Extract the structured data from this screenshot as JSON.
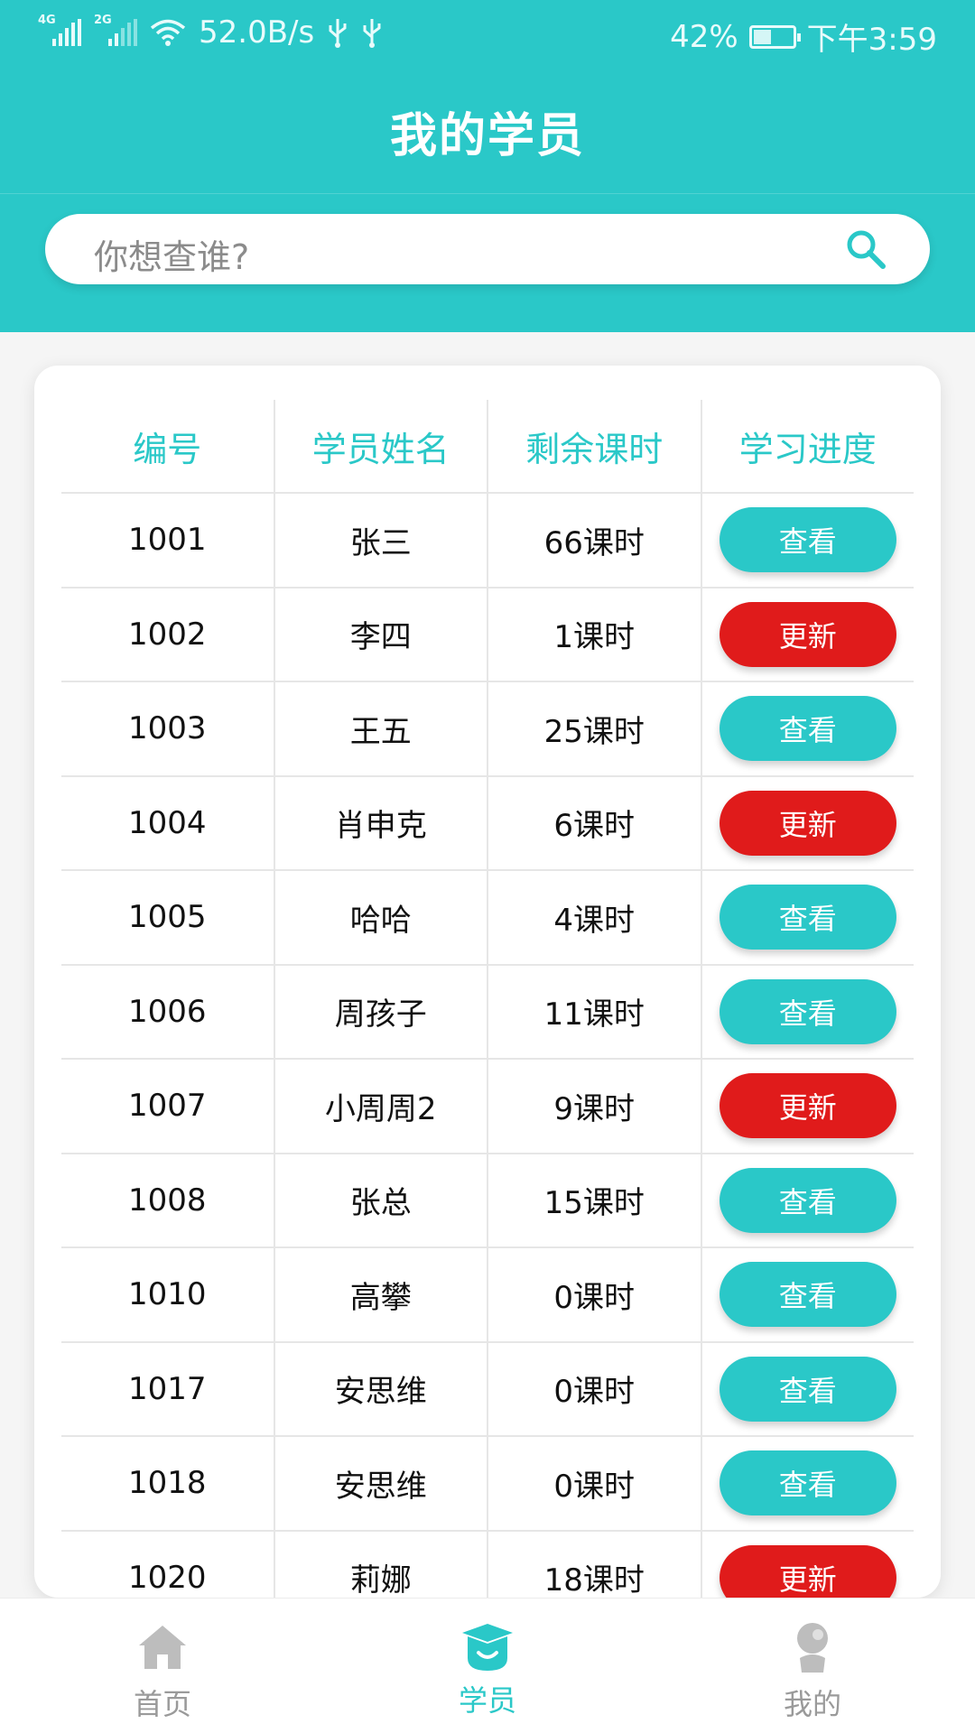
{
  "status_bar": {
    "net1": "4G",
    "net2": "2G",
    "speed": "52.0B/s",
    "battery_percent": "42%",
    "battery_level": 0.42,
    "time": "下午3:59"
  },
  "header": {
    "title": "我的学员"
  },
  "search": {
    "placeholder": "你想查谁?"
  },
  "table": {
    "columns": [
      "编号",
      "学员姓名",
      "剩余课时",
      "学习进度"
    ],
    "rows": [
      {
        "id": "1001",
        "name": "张三",
        "hours": "66课时",
        "action": "查看",
        "type": "view"
      },
      {
        "id": "1002",
        "name": "李四",
        "hours": "1课时",
        "action": "更新",
        "type": "update"
      },
      {
        "id": "1003",
        "name": "王五",
        "hours": "25课时",
        "action": "查看",
        "type": "view"
      },
      {
        "id": "1004",
        "name": "肖申克",
        "hours": "6课时",
        "action": "更新",
        "type": "update"
      },
      {
        "id": "1005",
        "name": "哈哈",
        "hours": "4课时",
        "action": "查看",
        "type": "view"
      },
      {
        "id": "1006",
        "name": "周孩子",
        "hours": "11课时",
        "action": "查看",
        "type": "view"
      },
      {
        "id": "1007",
        "name": "小周周2",
        "hours": "9课时",
        "action": "更新",
        "type": "update"
      },
      {
        "id": "1008",
        "name": "张总",
        "hours": "15课时",
        "action": "查看",
        "type": "view"
      },
      {
        "id": "1010",
        "name": "高攀",
        "hours": "0课时",
        "action": "查看",
        "type": "view"
      },
      {
        "id": "1017",
        "name": "安思维",
        "hours": "0课时",
        "action": "查看",
        "type": "view"
      },
      {
        "id": "1018",
        "name": "安思维",
        "hours": "0课时",
        "action": "查看",
        "type": "view"
      },
      {
        "id": "1020",
        "name": "莉娜",
        "hours": "18课时",
        "action": "更新",
        "type": "update"
      }
    ]
  },
  "tabbar": {
    "items": [
      {
        "label": "首页",
        "icon": "home-icon",
        "active": false
      },
      {
        "label": "学员",
        "icon": "graduation-cap-icon",
        "active": true
      },
      {
        "label": "我的",
        "icon": "user-icon",
        "active": false
      }
    ]
  },
  "colors": {
    "accent": "#2ac8c8",
    "danger": "#e01b1b",
    "inactive": "#9a9a9a"
  }
}
